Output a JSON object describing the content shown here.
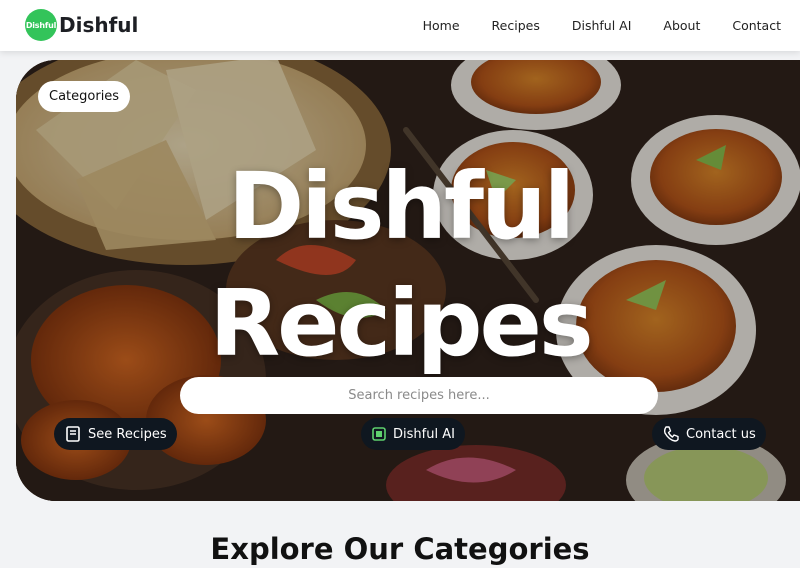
{
  "brand": {
    "logo_text": "Dishful",
    "name": "Dishful",
    "color": "#33c45a"
  },
  "nav": {
    "items": [
      {
        "label": "Home"
      },
      {
        "label": "Recipes"
      },
      {
        "label": "Dishful AI"
      },
      {
        "label": "About"
      },
      {
        "label": "Contact"
      }
    ]
  },
  "hero": {
    "categories_label": "Categories",
    "title_line1": "Dishful",
    "title_line2": "Recipes",
    "search_placeholder": "Search recipes here...",
    "buttons": {
      "see_recipes": "See Recipes",
      "dishful_ai": "Dishful AI",
      "contact": "Contact us"
    }
  },
  "section": {
    "title": "Explore Our Categories"
  }
}
